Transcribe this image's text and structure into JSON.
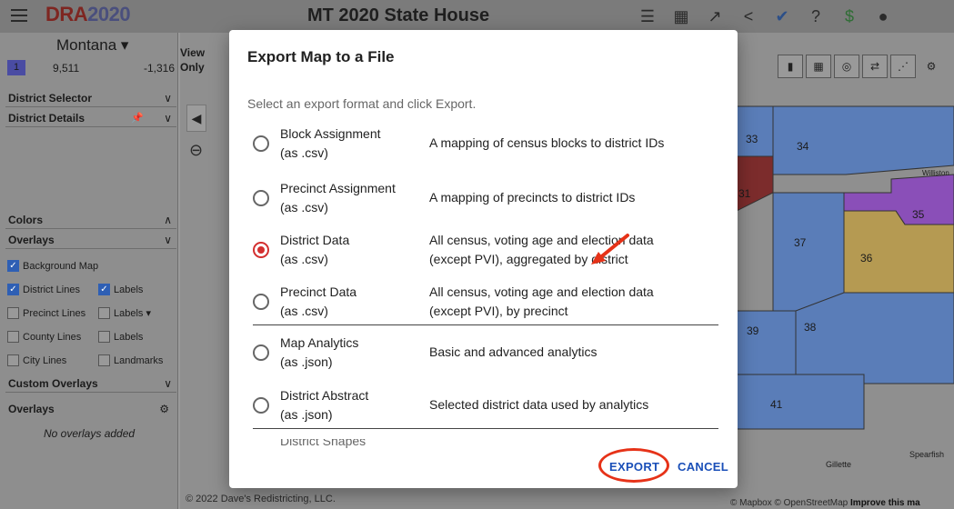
{
  "topbar": {
    "brand_part1": "DRA",
    "brand_part2": "2020",
    "title": "MT 2020 State House",
    "icons": [
      "list-icon",
      "table-icon",
      "share-arrow-icon",
      "share-icon",
      "twitter-icon",
      "help-icon",
      "dollar-icon",
      "account-icon"
    ]
  },
  "sidebar": {
    "state": "Montana",
    "stats": {
      "district": "1",
      "population": "9,511",
      "deviation": "-1,316"
    },
    "panels": {
      "district_selector": "District Selector",
      "district_details": "District Details",
      "colors": "Colors",
      "overlays": "Overlays",
      "custom_overlays": "Custom Overlays",
      "overlays2": "Overlays"
    },
    "checks": {
      "background_map": "Background Map",
      "district_lines": "District Lines",
      "labels1": "Labels",
      "precinct_lines": "Precinct Lines",
      "labels2": "Labels",
      "county_lines": "County Lines",
      "labels3": "Labels",
      "city_lines": "City Lines",
      "landmarks": "Landmarks"
    },
    "no_overlays": "No overlays added"
  },
  "map": {
    "view_only_1": "View",
    "view_only_2": "Only",
    "copyright": "© 2022 Dave's Redistricting, LLC.",
    "attribution_prefix": "© Mapbox © OpenStreetMap",
    "attribution_link": "Improve this ma",
    "districts": [
      "33",
      "34",
      "31",
      "35",
      "37",
      "36",
      "39",
      "38",
      "41"
    ],
    "place_labels": [
      "Williston",
      "Gillette",
      "Spearfish"
    ],
    "colors": {
      "d35": "#8a4fb8",
      "d36": "#b59a52",
      "d_blue": "#5a7db8"
    }
  },
  "modal": {
    "title": "Export Map to a File",
    "subtitle": "Select an export format and click Export.",
    "options": [
      {
        "name": "Block Assignment",
        "ext": "(as .csv)",
        "desc1": "A mapping of census blocks to district IDs",
        "desc2": "",
        "selected": false
      },
      {
        "name": "Precinct Assignment",
        "ext": "(as .csv)",
        "desc1": "A mapping of precincts to district IDs",
        "desc2": "",
        "selected": false
      },
      {
        "name": "District Data",
        "ext": "(as .csv)",
        "desc1": "All census, voting age and election data",
        "desc2": "(except PVI), aggregated by district",
        "selected": true
      },
      {
        "name": "Precinct Data",
        "ext": "(as .csv)",
        "desc1": "All census, voting age and election data",
        "desc2": "(except PVI), by precinct",
        "selected": false
      },
      {
        "name": "Map Analytics",
        "ext": "(as .json)",
        "desc1": "Basic and advanced analytics",
        "desc2": "",
        "selected": false
      },
      {
        "name": "District Abstract",
        "ext": "(as .json)",
        "desc1": "Selected district data used by analytics",
        "desc2": "",
        "selected": false
      }
    ],
    "partial_option": "District Shapes",
    "export_label": "EXPORT",
    "cancel_label": "CANCEL",
    "accent": "#d32f2f"
  }
}
